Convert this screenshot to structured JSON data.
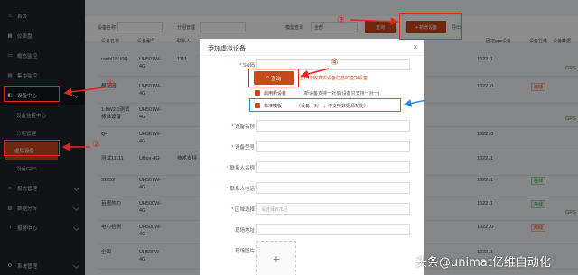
{
  "sidebar": {
    "items": [
      {
        "label": "首页",
        "icon": "home-icon"
      },
      {
        "label": "仪表盘",
        "icon": "dashboard-icon"
      },
      {
        "label": "概态监控",
        "icon": "monitor-icon"
      },
      {
        "label": "集中监控",
        "icon": "grid-icon"
      },
      {
        "label": "设备中心",
        "icon": "device-icon"
      },
      {
        "label": "设备监控中心"
      },
      {
        "label": "分组管理"
      },
      {
        "label": "虚拟设备"
      },
      {
        "label": "设备GPS"
      },
      {
        "label": "报志管理",
        "icon": "log-icon"
      },
      {
        "label": "数据分析",
        "icon": "chart-icon"
      },
      {
        "label": "报警中心",
        "icon": "alarm-icon"
      },
      {
        "label": "系统管理",
        "icon": "settings-icon"
      }
    ]
  },
  "filter": {
    "label1": "设备名称",
    "label2": "分组管理",
    "label3": "模型查询",
    "select_value": "全部",
    "query_label": "查询",
    "add_label": "+ 新增设备",
    "export_label": "导出"
  },
  "table": {
    "headers": [
      "设备名称",
      "设备型号",
      "联系人",
      "",
      "",
      "",
      "",
      "",
      "",
      "固定gps设备",
      "设备在线",
      "设备数据"
    ],
    "rows": [
      {
        "name": "rauhl18U0G",
        "model": "UH507W-4G",
        "contact": "1111",
        "sn": "102211",
        "tag": "",
        "gps": "GPS"
      },
      {
        "name": "樱花园",
        "model": "UH507W-4G",
        "contact": "",
        "sn": "102210...",
        "tag": "离线",
        "gps": ""
      },
      {
        "name": "1.0W2.0测试标准设备",
        "model": "UH507W-4G",
        "contact": "",
        "sn": "",
        "tag": "",
        "gps": "GPS"
      },
      {
        "name": "Q4",
        "model": "UH507W-4G",
        "contact": "",
        "sn": "102210",
        "tag": "",
        "gps": ""
      },
      {
        "name": "测试11111",
        "model": "UBox-4G",
        "contact": "技术支持",
        "sn": "102211",
        "tag": "",
        "gps": ""
      },
      {
        "name": "31232",
        "model": "UH507W-4G",
        "contact": "",
        "sn": "102211",
        "tag": "在线",
        "gps": ""
      },
      {
        "name": "苗圃热力",
        "model": "UH500W-4G",
        "contact": "",
        "sn": "102211",
        "tag": "在线",
        "gps": "GPS"
      },
      {
        "name": "电力检测",
        "model": "UH500W-4G",
        "contact": "",
        "sn": "102210",
        "tag": "离线",
        "gps": ""
      },
      {
        "name": "全面",
        "model": "UH500W-4G",
        "contact": "",
        "sn": "102211",
        "tag": "",
        "gps": ""
      }
    ]
  },
  "modal": {
    "title": "添加虚拟设备",
    "close": "×",
    "sn_label": "SN码",
    "query_button": "查询",
    "query_hint": "显示接收真实设备信息的虚拟设备",
    "enable_label": "启用新设备",
    "enable_note": "（新设备支持一对多(设备只支持一对一)",
    "template_label": "标准模板",
    "template_note": "（设备一对一，不支持数据源功能）",
    "fields": [
      {
        "label": "设备名称",
        "required": true,
        "placeholder": ""
      },
      {
        "label": "设备型号",
        "required": true,
        "placeholder": ""
      },
      {
        "label": "联系人名称",
        "required": true,
        "placeholder": ""
      },
      {
        "label": "联系人电话",
        "required": true,
        "placeholder": ""
      },
      {
        "label": "区域选择",
        "required": true,
        "placeholder": "请选择省市区"
      },
      {
        "label": "现场地址",
        "required": false,
        "placeholder": ""
      },
      {
        "label": "现场图片",
        "required": false,
        "placeholder": ""
      }
    ],
    "upload_plus": "+"
  },
  "annotations": {
    "n1": "①",
    "n2": "②",
    "n3": "③",
    "n4": "④"
  },
  "watermark": "头条@unimat亿维自动化",
  "colors": {
    "accent": "#c7491d",
    "sidebar_bg": "#1f232b",
    "annotation_red": "#e0261e",
    "annotation_blue": "#2a8fd6"
  }
}
